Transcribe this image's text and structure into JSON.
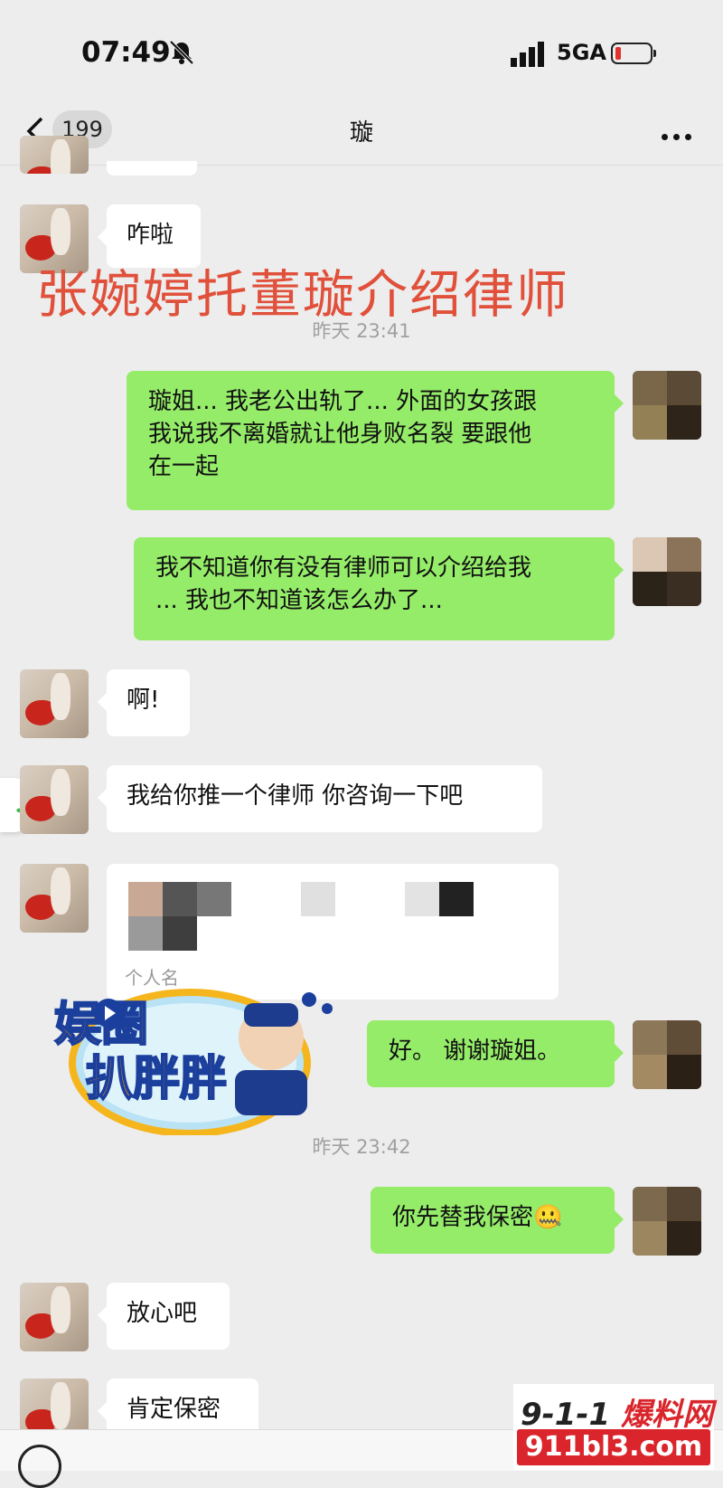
{
  "status_bar": {
    "time": "07:49",
    "network": "5GA",
    "battery_level": 0.1
  },
  "nav": {
    "unread_count": "199",
    "title": "璇"
  },
  "overlay_caption": "张婉婷托董璇介绍律师",
  "messages": [
    {
      "side": "left",
      "text": "咋啦"
    },
    {
      "side": "timestamp",
      "text": "昨天 23:41"
    },
    {
      "side": "right",
      "lines": [
        "璇姐... 我老公出轨了... 外面的女孩跟",
        "我说我不离婚就让他身败名裂 要跟他",
        "在一起"
      ]
    },
    {
      "side": "right",
      "lines": [
        "我不知道你有没有律师可以介绍给我",
        "... 我也不知道该怎么办了..."
      ]
    },
    {
      "side": "left",
      "text": "啊!"
    },
    {
      "side": "left",
      "text": "我给你推一个律师 你咨询一下吧"
    },
    {
      "side": "left",
      "card_label": "个人名"
    },
    {
      "side": "right",
      "text": "好。 谢谢璇姐。"
    },
    {
      "side": "timestamp",
      "text": "昨天 23:42"
    },
    {
      "side": "right",
      "text": "你先替我保密🤐"
    },
    {
      "side": "left",
      "text": "放心吧"
    },
    {
      "side": "left",
      "text": "肯定保密"
    }
  ],
  "sticker": {
    "line1": "娱圈",
    "line2": "扒胖胖",
    "icon": "play-icon"
  },
  "watermark": {
    "top_a": "9-1-1",
    "top_b": "爆料网",
    "url": "911bl3.com"
  },
  "colors": {
    "outgoing_bubble": "#95ec69",
    "incoming_bubble": "#ffffff",
    "background": "#ededed",
    "caption": "#e0503a"
  }
}
